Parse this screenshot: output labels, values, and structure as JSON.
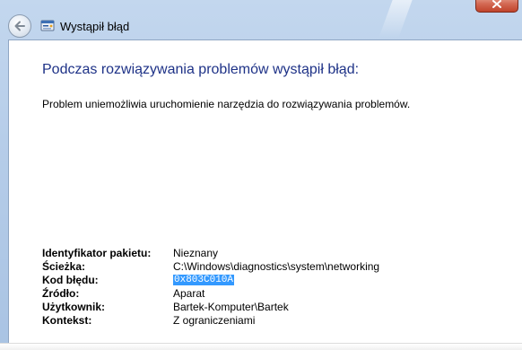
{
  "window": {
    "title": "Wystąpił błąd"
  },
  "content": {
    "heading": "Podczas rozwiązywania problemów wystąpił błąd:",
    "message": "Problem uniemożliwia uruchomienie narzędzia do rozwiązywania problemów.",
    "details": [
      {
        "label": "Identyfikator pakietu:",
        "value": "Nieznany"
      },
      {
        "label": "Ścieżka:",
        "value": "C:\\Windows\\diagnostics\\system\\networking"
      },
      {
        "label": "Kod błędu:",
        "value": "0x803C010A",
        "selected": true
      },
      {
        "label": "Źródło:",
        "value": "Aparat"
      },
      {
        "label": "Użytkownik:",
        "value": "Bartek-Komputer\\Bartek"
      },
      {
        "label": "Kontekst:",
        "value": "Z ograniczeniami"
      }
    ]
  },
  "icons": {
    "back": "back-arrow-icon",
    "app": "troubleshooter-app-icon",
    "close": "close-icon"
  },
  "colors": {
    "heading": "#1e3287",
    "selection": "#3399ff"
  }
}
